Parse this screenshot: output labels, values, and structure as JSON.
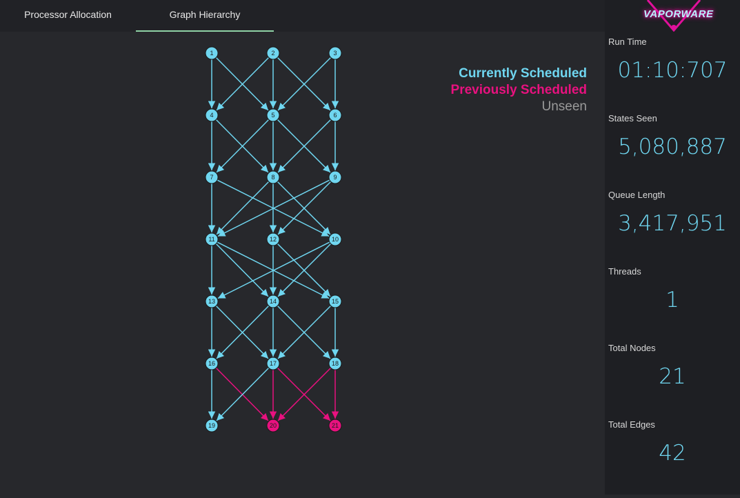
{
  "tabs": [
    {
      "label": "Processor Allocation"
    },
    {
      "label": "Graph Hierarchy"
    }
  ],
  "logo": {
    "text": "VAPORWARE"
  },
  "legend": {
    "current": "Currently Scheduled",
    "previous": "Previously Scheduled",
    "unseen": "Unseen"
  },
  "stats": {
    "run_time": {
      "label": "Run Time",
      "value": "01:10:707"
    },
    "states_seen": {
      "label": "States Seen",
      "value": "5,080,887"
    },
    "queue_length": {
      "label": "Queue Length",
      "value": "3,417,951"
    },
    "threads": {
      "label": "Threads",
      "value": "1"
    },
    "total_nodes": {
      "label": "Total Nodes",
      "value": "21"
    },
    "total_edges": {
      "label": "Total Edges",
      "value": "42"
    }
  },
  "colors": {
    "current": "#6fd6f0",
    "previous": "#e8117f",
    "accent_tab": "#8fd3a6"
  },
  "graph": {
    "nodes": [
      {
        "id": "1",
        "state": "current"
      },
      {
        "id": "2",
        "state": "current"
      },
      {
        "id": "3",
        "state": "current"
      },
      {
        "id": "4",
        "state": "current"
      },
      {
        "id": "5",
        "state": "current"
      },
      {
        "id": "6",
        "state": "current"
      },
      {
        "id": "7",
        "state": "current"
      },
      {
        "id": "8",
        "state": "current"
      },
      {
        "id": "9",
        "state": "current"
      },
      {
        "id": "11",
        "state": "current"
      },
      {
        "id": "12",
        "state": "current"
      },
      {
        "id": "10",
        "state": "current"
      },
      {
        "id": "13",
        "state": "current"
      },
      {
        "id": "14",
        "state": "current"
      },
      {
        "id": "15",
        "state": "current"
      },
      {
        "id": "16",
        "state": "current"
      },
      {
        "id": "17",
        "state": "current"
      },
      {
        "id": "18",
        "state": "current"
      },
      {
        "id": "19",
        "state": "current"
      },
      {
        "id": "20",
        "state": "previous"
      },
      {
        "id": "21",
        "state": "previous"
      }
    ],
    "edges": [
      [
        "1",
        "4",
        "current"
      ],
      [
        "1",
        "5",
        "current"
      ],
      [
        "2",
        "4",
        "current"
      ],
      [
        "2",
        "5",
        "current"
      ],
      [
        "2",
        "6",
        "current"
      ],
      [
        "3",
        "5",
        "current"
      ],
      [
        "3",
        "6",
        "current"
      ],
      [
        "4",
        "7",
        "current"
      ],
      [
        "4",
        "8",
        "current"
      ],
      [
        "5",
        "7",
        "current"
      ],
      [
        "5",
        "8",
        "current"
      ],
      [
        "5",
        "9",
        "current"
      ],
      [
        "6",
        "8",
        "current"
      ],
      [
        "6",
        "9",
        "current"
      ],
      [
        "7",
        "11",
        "current"
      ],
      [
        "7",
        "10",
        "current"
      ],
      [
        "8",
        "11",
        "current"
      ],
      [
        "8",
        "12",
        "current"
      ],
      [
        "8",
        "10",
        "current"
      ],
      [
        "9",
        "11",
        "current"
      ],
      [
        "9",
        "12",
        "current"
      ],
      [
        "11",
        "13",
        "current"
      ],
      [
        "11",
        "14",
        "current"
      ],
      [
        "11",
        "15",
        "current"
      ],
      [
        "12",
        "14",
        "current"
      ],
      [
        "12",
        "15",
        "current"
      ],
      [
        "10",
        "13",
        "current"
      ],
      [
        "10",
        "14",
        "current"
      ],
      [
        "13",
        "16",
        "current"
      ],
      [
        "13",
        "17",
        "current"
      ],
      [
        "14",
        "16",
        "current"
      ],
      [
        "14",
        "17",
        "current"
      ],
      [
        "14",
        "18",
        "current"
      ],
      [
        "15",
        "17",
        "current"
      ],
      [
        "15",
        "18",
        "current"
      ],
      [
        "16",
        "19",
        "current"
      ],
      [
        "16",
        "20",
        "previous"
      ],
      [
        "17",
        "19",
        "current"
      ],
      [
        "17",
        "20",
        "previous"
      ],
      [
        "17",
        "21",
        "previous"
      ],
      [
        "18",
        "20",
        "previous"
      ],
      [
        "18",
        "21",
        "previous"
      ]
    ]
  }
}
